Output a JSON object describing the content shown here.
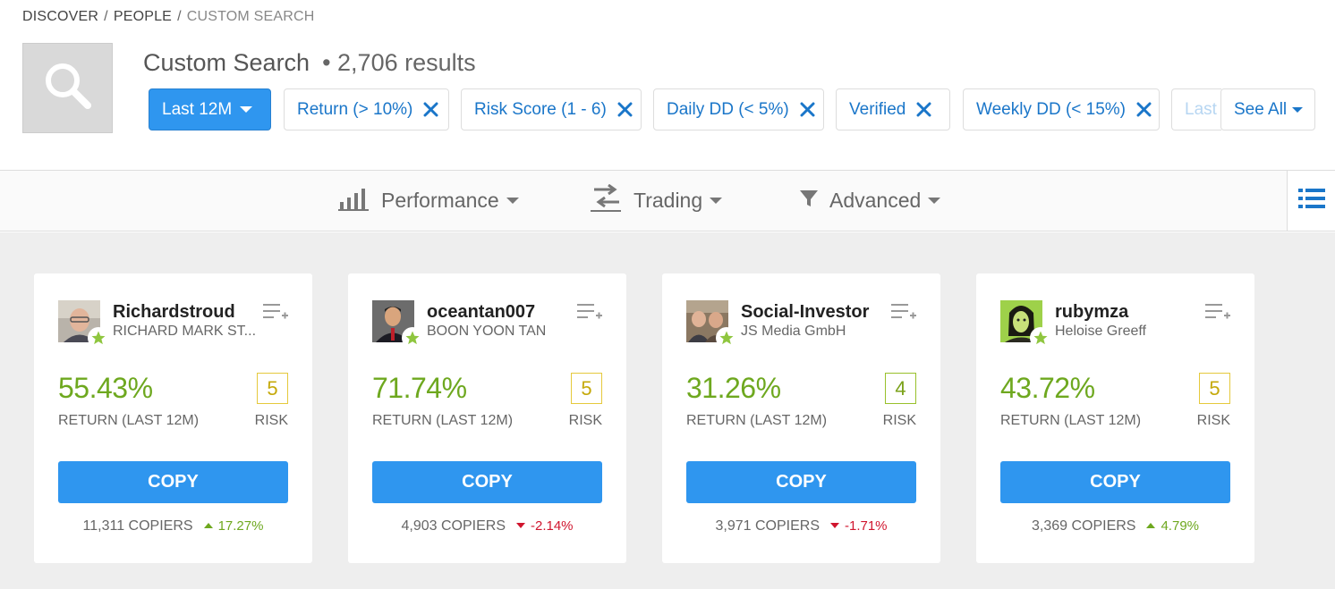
{
  "breadcrumb": {
    "discover": "DISCOVER",
    "people": "PEOPLE",
    "current": "CUSTOM SEARCH",
    "separator": "/"
  },
  "header": {
    "title": "Custom Search",
    "results": "• 2,706 results",
    "search_icon": "magnifier-icon"
  },
  "filters": {
    "period": "Last 12M",
    "chips": [
      "Return (> 10%)",
      "Risk Score (1 - 6)",
      "Daily DD (< 5%)",
      "Verified",
      "Weekly DD (< 15%)"
    ],
    "overflow_chip": "Last",
    "see_all": "See All"
  },
  "toolbar": {
    "performance": "Performance",
    "trading": "Trading",
    "advanced": "Advanced",
    "icons": [
      "bar-chart-icon",
      "swap-arrows-icon",
      "filter-funnel-icon",
      "list-view-icon"
    ]
  },
  "colors": {
    "accent": "#2f96ef",
    "link": "#1a76c9",
    "positive": "#6ea81f",
    "negative": "#d0152e",
    "risk_yellow": "#e5c93c",
    "risk_green": "#98c02b"
  },
  "cards": [
    {
      "username": "Richardstroud",
      "fullname": "RICHARD MARK ST...",
      "return": "55.43%",
      "return_label": "RETURN (LAST 12M)",
      "risk": "5",
      "risk_label": "RISK",
      "copy": "COPY",
      "copiers": "11,311 COPIERS",
      "change": "17.27%",
      "direction": "up"
    },
    {
      "username": "oceantan007",
      "fullname": "BOON YOON TAN",
      "return": "71.74%",
      "return_label": "RETURN (LAST 12M)",
      "risk": "5",
      "risk_label": "RISK",
      "copy": "COPY",
      "copiers": "4,903 COPIERS",
      "change": "-2.14%",
      "direction": "down"
    },
    {
      "username": "Social-Investor",
      "fullname": "JS Media GmbH",
      "return": "31.26%",
      "return_label": "RETURN (LAST 12M)",
      "risk": "4",
      "risk_label": "RISK",
      "copy": "COPY",
      "copiers": "3,971 COPIERS",
      "change": "-1.71%",
      "direction": "down"
    },
    {
      "username": "rubymza",
      "fullname": "Heloise Greeff",
      "return": "43.72%",
      "return_label": "RETURN (LAST 12M)",
      "risk": "5",
      "risk_label": "RISK",
      "copy": "COPY",
      "copiers": "3,369 COPIERS",
      "change": "4.79%",
      "direction": "up"
    }
  ]
}
